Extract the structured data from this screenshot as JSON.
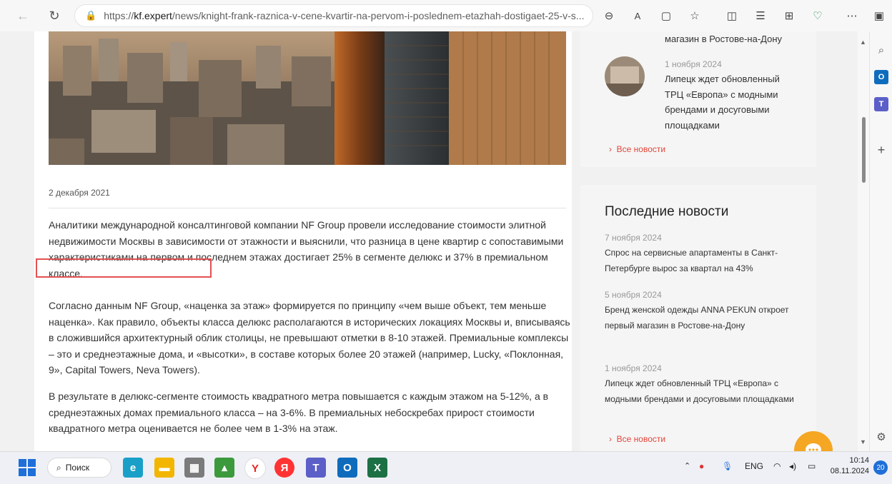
{
  "browser": {
    "url_prefix": "https://",
    "url_host": "kf.expert",
    "url_path": "/news/knight-frank-raznica-v-cene-kvartir-na-pervom-i-poslednem-etazhah-dostigaet-25-v-s..."
  },
  "article": {
    "date": "2 декабря 2021",
    "paragraphs": [
      "Аналитики международной консалтинговой компании NF Group провели исследование стоимости элитной недвижимости Москвы в зависимости от этажности и выяснили, что разница в цене квартир с сопоставимыми характеристиками на первом и последнем этажах достигает 25% в сегменте делюкс и 37% в премиальном классе.",
      "Согласно данным NF Group, «наценка за этаж» формируется по принципу «чем выше объект, тем меньше наценка». Как правило, объекты класса делюкс располагаются в исторических локациях Москвы и, вписываясь в сложившийся архитектурный облик столицы, не превышают отметки в 8-10 этажей. Премиальные комплексы – это и среднеэтажные дома, и «высотки», в составе которых более 20 этажей (например, Lucky, «Поклонная, 9», Capital Towers, Neva Towers).",
      "В результате в делюкс-сегменте стоимость квадратного метра повышается с каждым этажом на 5-12%, а в среднеэтажных домах премиального класса – на 3-6%. В премиальных небоскребах прирост стоимости квадратного метра оценивается не более чем в 1-3% на этаж."
    ]
  },
  "sidebar_top": {
    "cut_title": "магазин в Ростове-на-Дону",
    "item_date": "1 ноября 2024",
    "item_title": "Липецк ждет обновленный ТРЦ «Европа» с модными брендами и досуговыми площадками",
    "all_news": "Все новости"
  },
  "latest": {
    "heading": "Последние новости",
    "items": [
      {
        "date": "7 ноября 2024",
        "title": "Спрос на сервисные апартаменты в Санкт-Петербурге вырос за квартал на 43%"
      },
      {
        "date": "5 ноября 2024",
        "title": "Бренд женской одежды ANNA PEKUN откроет первый магазин в Ростове-на-Дону"
      },
      {
        "date": "1 ноября 2024",
        "title": "Липецк ждет обновленный ТРЦ «Европа» с модными брендами и досуговыми площадками"
      }
    ],
    "all_news": "Все новости"
  },
  "taskbar": {
    "search_label": "Поиск",
    "lang": "ENG",
    "time": "10:14",
    "date": "08.11.2024",
    "notifications": "20"
  },
  "colors": {
    "accent_red": "#e0463b",
    "highlight_border": "#e35151",
    "chat_orange": "#f5a623"
  }
}
